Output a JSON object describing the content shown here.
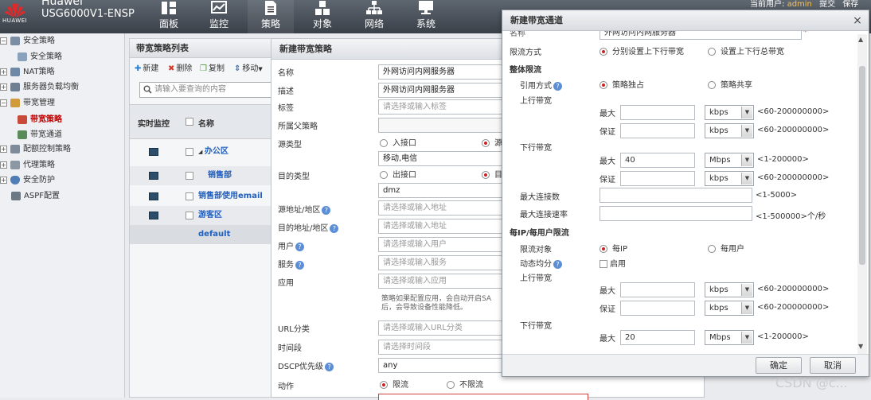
{
  "header": {
    "brand": "Huawei",
    "logo_text": "HUAWEI",
    "model": "USG6000V1-ENSP",
    "nav": [
      "面板",
      "监控",
      "策略",
      "对象",
      "网络",
      "系统"
    ],
    "user_prefix": "当前用户:",
    "user_name": "admin",
    "submit": "提交",
    "save": "保存"
  },
  "tree": {
    "items": [
      {
        "label": "安全策略"
      },
      {
        "label": "安全策略"
      },
      {
        "label": "NAT策略"
      },
      {
        "label": "服务器负载均衡"
      },
      {
        "label": "带宽管理"
      },
      {
        "label": "带宽策略"
      },
      {
        "label": "带宽通道"
      },
      {
        "label": "配额控制策略"
      },
      {
        "label": "代理策略"
      },
      {
        "label": "安全防护"
      },
      {
        "label": "ASPF配置"
      }
    ]
  },
  "list": {
    "title": "带宽策略列表",
    "toolbar": {
      "new": "新建",
      "delete": "删除",
      "copy": "复制",
      "move": "移动"
    },
    "search_placeholder": "请输入要查询的内容",
    "col_monitor": "实时监控",
    "col_name": "名称",
    "rows": [
      "办公区",
      "销售部",
      "销售部使用email",
      "游客区",
      "default"
    ]
  },
  "form": {
    "title": "新建带宽策略",
    "name_label": "名称",
    "name_value": "外网访问内网服务器",
    "desc_label": "描述",
    "desc_value": "外网访问内网服务器",
    "tag_label": "标签",
    "tag_placeholder": "请选择或输入标签",
    "parent_label": "所属父策略",
    "src_type_label": "源类型",
    "src_opt1": "入接口",
    "src_opt2": "源",
    "src_value": "移动,电信",
    "dst_type_label": "目的类型",
    "dst_opt1": "出接口",
    "dst_opt2": "目",
    "dst_value": "dmz",
    "src_addr_label": "源地址/地区",
    "src_addr_placeholder": "请选择或输入地址",
    "dst_addr_label": "目的地址/地区",
    "dst_addr_placeholder": "请选择或输入地址",
    "user_label": "用户",
    "user_placeholder": "请选择或输入用户",
    "service_label": "服务",
    "service_placeholder": "请选择或输入服务",
    "app_label": "应用",
    "app_placeholder": "请选择或输入应用",
    "hint_line1": "策略如果配置应用，会自动开启SA",
    "hint_line2": "后，会导致设备性能降低。",
    "url_label": "URL分类",
    "url_placeholder": "请选择或输入URL分类",
    "time_label": "时间段",
    "time_placeholder": "请选择时间段",
    "dscp_label": "DSCP优先级",
    "dscp_value": "any",
    "action_label": "动作",
    "action_opt1": "限流",
    "action_opt2": "不限流"
  },
  "dialog": {
    "title": "新建带宽通道",
    "name_label": "名称",
    "name_value": "外网访问内网服务器",
    "limit_mode_label": "限流方式",
    "limit_mode_opt1": "分别设置上下行带宽",
    "limit_mode_opt2": "设置上下行总带宽",
    "overall_section": "整体限流",
    "ref_mode_label": "引用方式",
    "ref_opt1": "策略独占",
    "ref_opt2": "策略共享",
    "up_bw_label": "上行带宽",
    "down_bw_label": "下行带宽",
    "max_label": "最大",
    "guar_label": "保证",
    "kbps": "kbps",
    "Mbps": "Mbps",
    "range_kbps": "<60-200000000>",
    "range_mbps": "<1-200000>",
    "overall_down_max": "40",
    "max_conn_label": "最大连接数",
    "max_conn_range": "<1-5000>",
    "max_conn_rate_label": "最大连接速率",
    "max_conn_rate_range": "<1-500000>个/秒",
    "per_ip_section": "每IP/每用户限流",
    "limit_obj_label": "限流对象",
    "obj_opt1": "每IP",
    "obj_opt2": "每用户",
    "dyn_label": "动态均分",
    "dyn_opt": "启用",
    "per_down_max": "20",
    "ok": "确定",
    "cancel": "取消"
  },
  "watermark": "CSDN @c...",
  "colors": {
    "accent_red": "#d02020",
    "link_blue": "#1f5fbf",
    "header": "#4a525b"
  }
}
